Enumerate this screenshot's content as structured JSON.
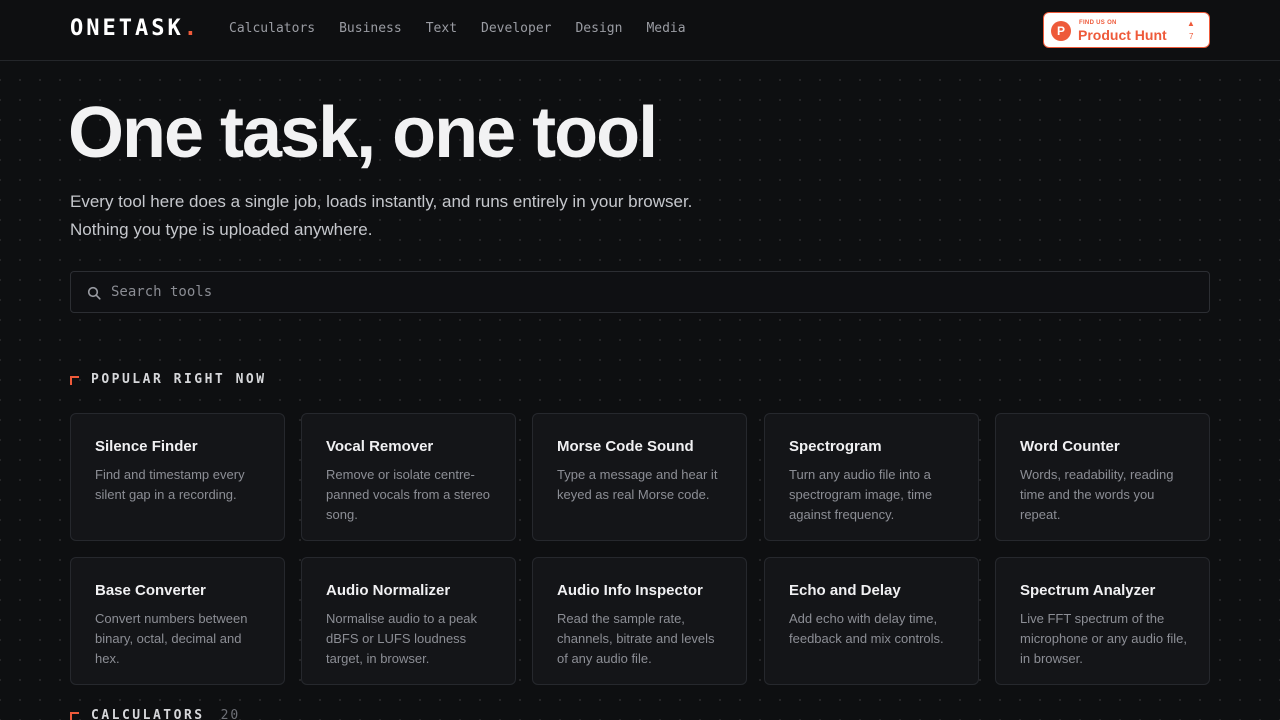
{
  "header": {
    "logo_text": "ONETASK",
    "logo_dot": ".",
    "nav": [
      "Calculators",
      "Business",
      "Text",
      "Developer",
      "Design",
      "Media"
    ],
    "product_hunt": {
      "find_label": "FIND US ON",
      "name": "Product Hunt",
      "upvotes": "7",
      "accent_color": "#ee5a3a"
    }
  },
  "hero": {
    "title": "One task, one tool",
    "subtitle_line1": "Every tool here does a single job, loads instantly, and runs entirely in your browser.",
    "subtitle_line2": "Nothing you type is uploaded anywhere."
  },
  "search": {
    "placeholder": "Search tools",
    "value": "",
    "icon": "search-icon"
  },
  "popular": {
    "title": "POPULAR RIGHT NOW",
    "tools": [
      {
        "title": "Silence Finder",
        "desc": "Find and timestamp every silent gap in a recording."
      },
      {
        "title": "Vocal Remover",
        "desc": "Remove or isolate centre-panned vocals from a stereo song."
      },
      {
        "title": "Morse Code Sound",
        "desc": "Type a message and hear it keyed as real Morse code."
      },
      {
        "title": "Spectrogram",
        "desc": "Turn any audio file into a spectrogram image, time against frequency."
      },
      {
        "title": "Word Counter",
        "desc": "Words, readability, reading time and the words you repeat."
      },
      {
        "title": "Base Converter",
        "desc": "Convert numbers between binary, octal, decimal and hex."
      },
      {
        "title": "Audio Normalizer",
        "desc": "Normalise audio to a peak dBFS or LUFS loudness target, in browser."
      },
      {
        "title": "Audio Info Inspector",
        "desc": "Read the sample rate, channels, bitrate and levels of any audio file."
      },
      {
        "title": "Echo and Delay",
        "desc": "Add echo with delay time, feedback and mix controls."
      },
      {
        "title": "Spectrum Analyzer",
        "desc": "Live FFT spectrum of the microphone or any audio file, in browser."
      }
    ]
  },
  "calculators": {
    "title": "CALCULATORS",
    "count": "20"
  }
}
